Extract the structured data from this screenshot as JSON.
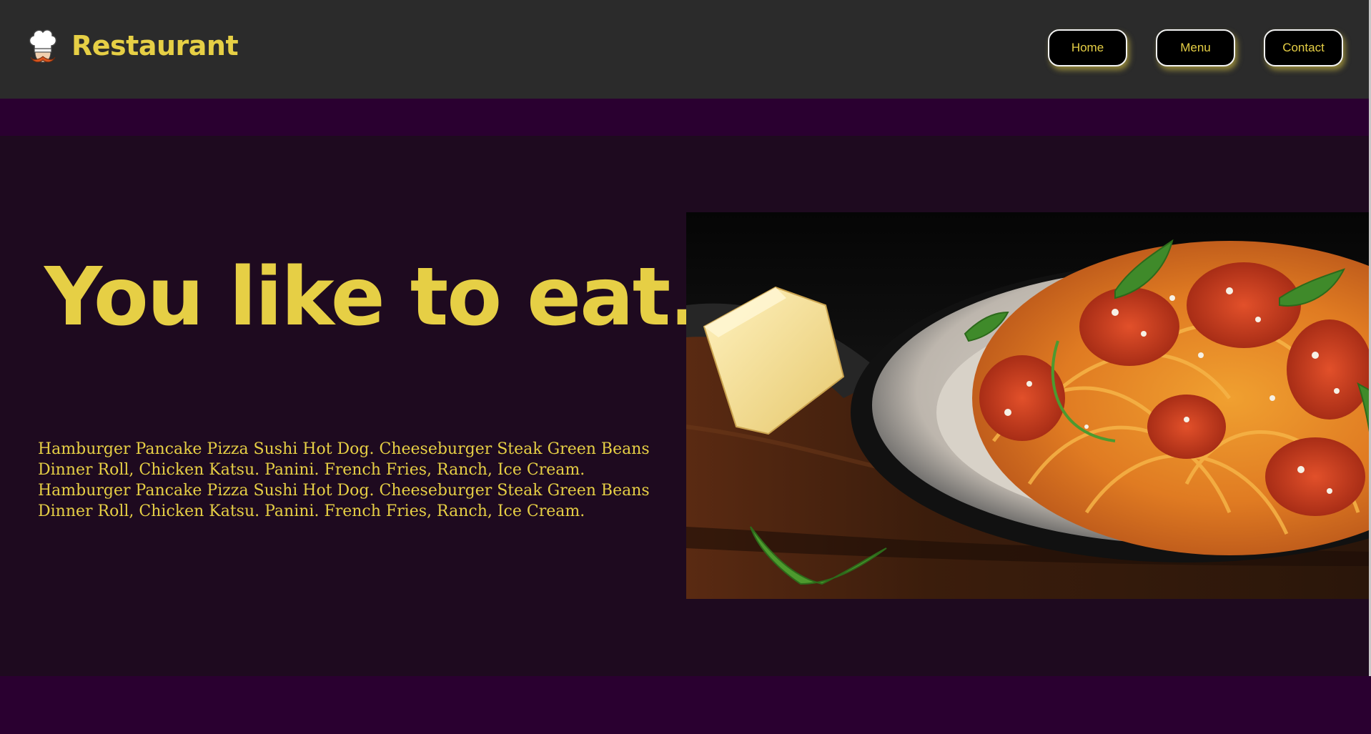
{
  "header": {
    "brand_name": "Restaurant",
    "logo_icon": "chef-hat-mustache-icon",
    "nav": {
      "home": "Home",
      "menu": "Menu",
      "contact": "Contact"
    }
  },
  "hero": {
    "headline": "You like to eat.",
    "description": "Hamburger Pancake Pizza Sushi Hot Dog. Cheeseburger Steak Green Beans Dinner Roll, Chicken Katsu. Panini. French Fries, Ranch, Ice Cream. Hamburger Pancake Pizza Sushi Hot Dog. Cheeseburger Steak Green Beans Dinner Roll, Chicken Katsu. Panini. French Fries, Ranch, Ice Cream.",
    "image_icon": "spaghetti-plate-photo"
  },
  "colors": {
    "accent": "#e6cf45",
    "header_bg": "#2b2b2b",
    "page_bg": "#2a0030",
    "hero_bg": "#1e0a1f",
    "button_bg": "#000000"
  }
}
